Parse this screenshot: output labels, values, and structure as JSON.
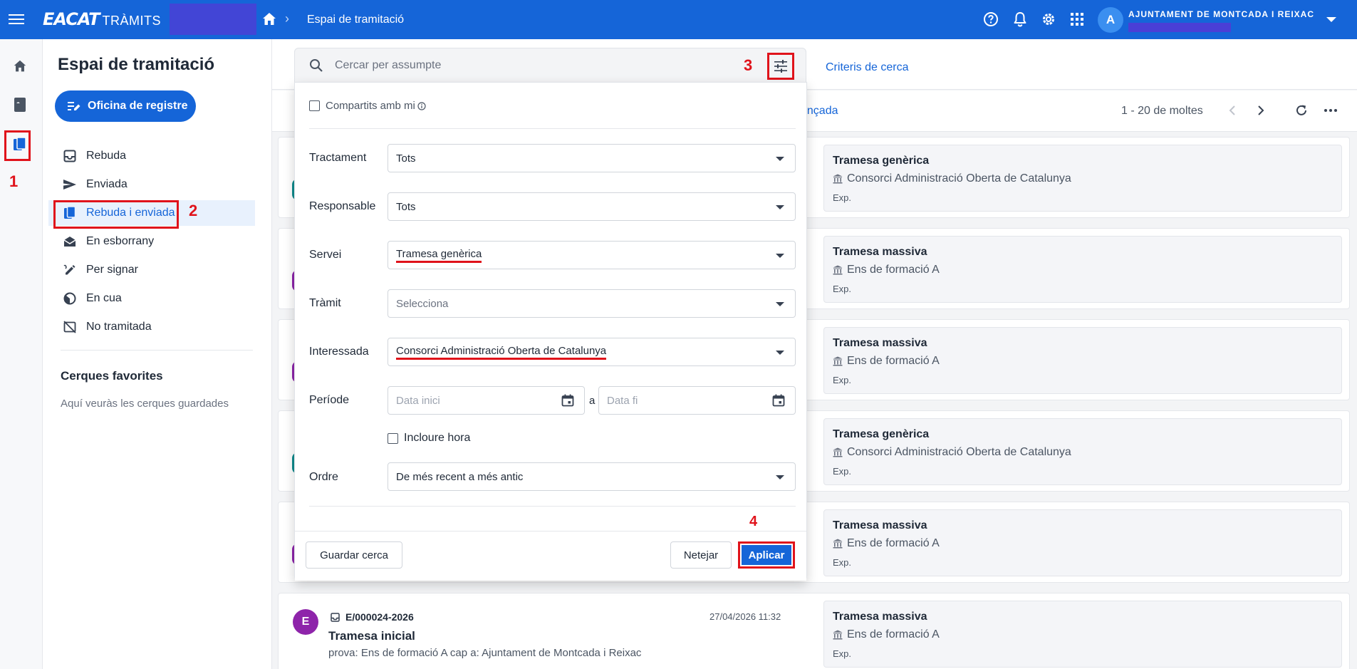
{
  "topbar": {
    "logo_main": "EACAT",
    "logo_sub": "TRÀMITS",
    "breadcrumb": "Espai de tramitació",
    "avatar_initial": "A",
    "org_name": "AJUNTAMENT DE MONTCADA I REIXAC",
    "icons": [
      "menu-icon",
      "home-icon",
      "help-icon",
      "bell-icon",
      "gear-icon",
      "apps-grid-icon",
      "chevron-down-icon"
    ]
  },
  "annotations": {
    "n1": "1",
    "n2": "2",
    "n3": "3",
    "n4": "4"
  },
  "sidebar": {
    "title": "Espai de tramitació",
    "office_button": "Oficina de registre",
    "items": [
      {
        "label": "Rebuda",
        "icon": "inbox-icon"
      },
      {
        "label": "Enviada",
        "icon": "send-icon"
      },
      {
        "label": "Rebuda i enviada",
        "icon": "copy-icon",
        "active": true
      },
      {
        "label": "En esborrany",
        "icon": "draft-mail-icon"
      },
      {
        "label": "Per signar",
        "icon": "signature-icon"
      },
      {
        "label": "En cua",
        "icon": "clock-half-icon"
      },
      {
        "label": "No tramitada",
        "icon": "no-process-icon"
      }
    ],
    "favorites_title": "Cerques favorites",
    "favorites_empty": "Aquí veuràs les cerques guardades"
  },
  "search": {
    "placeholder": "Cercar per assumpte",
    "criteria_link": "Criteris de cerca",
    "advanced_partial": "ançada"
  },
  "pager": {
    "range": "1 - 20 de moltes"
  },
  "filter_panel": {
    "shared_with_me": "Compartits amb mi",
    "rows": {
      "tractament": {
        "label": "Tractament",
        "value": "Tots"
      },
      "responsable": {
        "label": "Responsable",
        "value": "Tots"
      },
      "servei": {
        "label": "Servei",
        "value": "Tramesa genèrica"
      },
      "tramit": {
        "label": "Tràmit",
        "value": "Selecciona"
      },
      "interessada": {
        "label": "Interessada",
        "value": "Consorci Administració Oberta de Catalunya"
      },
      "periode": {
        "label": "Període",
        "start_placeholder": "Data inici",
        "separator": "a",
        "end_placeholder": "Data fi"
      },
      "ordre": {
        "label": "Ordre",
        "value": "De més recent a més antic"
      }
    },
    "include_time": "Incloure hora",
    "save_search": "Guardar cerca",
    "clear": "Netejar",
    "apply": "Aplicar"
  },
  "cards": [
    {
      "avatar": "",
      "avatar_color": "#0f8b8d",
      "service": "Tramesa genèrica",
      "org": "Consorci Administració Oberta de Catalunya",
      "exp": "Exp."
    },
    {
      "avatar": "",
      "avatar_color": "#8e24aa",
      "service": "Tramesa massiva",
      "org": "Ens de formació A",
      "exp": "Exp."
    },
    {
      "avatar": "",
      "avatar_color": "#8e24aa",
      "service": "Tramesa massiva",
      "org": "Ens de formació A",
      "exp": "Exp."
    },
    {
      "avatar": "",
      "avatar_color": "#0f8b8d",
      "service": "Tramesa genèrica",
      "org": "Consorci Administració Oberta de Catalunya",
      "exp": "Exp."
    },
    {
      "avatar": "",
      "avatar_color": "#8e24aa",
      "service": "Tramesa massiva",
      "org": "Ens de formació A",
      "exp": "Exp."
    },
    {
      "avatar": "E",
      "avatar_color": "#8e24aa",
      "id": "E/000024-2026",
      "date": "27/04/2026 11:32",
      "title": "Tramesa inicial",
      "desc": "prova: Ens de formació A cap a: Ajuntament de Montcada i Reixac",
      "service": "Tramesa massiva",
      "org": "Ens de formació A",
      "exp": "Exp."
    }
  ],
  "colors": {
    "brand_blue": "#1565d8",
    "annotation_red": "#e0131b"
  }
}
